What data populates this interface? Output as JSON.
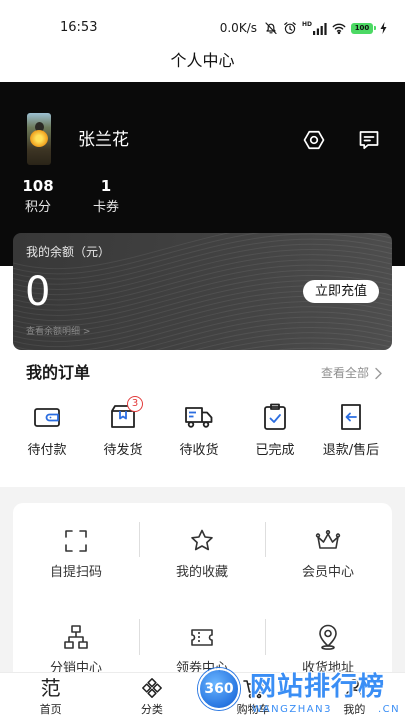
{
  "status_bar": {
    "time": "16:53",
    "net_speed": "0.0K/s",
    "signal_label": "HD",
    "battery_level": "100",
    "icons": [
      "mute-icon",
      "alarm-icon",
      "signal-icon",
      "wifi-icon",
      "battery-icon",
      "charging-icon"
    ]
  },
  "header": {
    "title": "个人中心"
  },
  "profile": {
    "name": "张兰花",
    "avatar": "avatar-photo",
    "actions": [
      {
        "icon": "settings-icon"
      },
      {
        "icon": "message-icon"
      }
    ],
    "stats": [
      {
        "value": "108",
        "label": "积分"
      },
      {
        "value": "1",
        "label": "卡券"
      }
    ]
  },
  "balance": {
    "label": "我的余额（元）",
    "amount": "0",
    "recharge_label": "立即充值",
    "detail_link": "查看余额明细 >"
  },
  "orders": {
    "title": "我的订单",
    "view_all": "查看全部",
    "items": [
      {
        "label": "待付款",
        "icon": "wallet-icon"
      },
      {
        "label": "待发货",
        "icon": "package-icon",
        "badge": "3"
      },
      {
        "label": "待收货",
        "icon": "truck-icon"
      },
      {
        "label": "已完成",
        "icon": "clipboard-check-icon"
      },
      {
        "label": "退款/售后",
        "icon": "refund-icon"
      }
    ]
  },
  "services": {
    "items": [
      {
        "label": "自提扫码",
        "icon": "scan-icon"
      },
      {
        "label": "我的收藏",
        "icon": "star-icon"
      },
      {
        "label": "会员中心",
        "icon": "crown-icon"
      },
      {
        "label": "分销中心",
        "icon": "org-chart-icon"
      },
      {
        "label": "领券中心",
        "icon": "ticket-icon"
      },
      {
        "label": "收货地址",
        "icon": "location-icon"
      }
    ]
  },
  "bottom_nav": {
    "items": [
      {
        "label": "首页",
        "icon": "home-logo-icon",
        "glyph": "范"
      },
      {
        "label": "分类",
        "icon": "category-icon"
      },
      {
        "label": "购物车",
        "icon": "cart-icon"
      },
      {
        "label": "我的",
        "icon": "user-icon"
      }
    ]
  },
  "watermark": {
    "badge": "360",
    "title": "网站排行榜",
    "url_start": "WANGZHAN3",
    "url_end": ".CN"
  },
  "colors": {
    "banner": "#0a0a0a",
    "balance_card": "#3d3d3d",
    "accent_blue": "#2b6de0",
    "badge_red": "#e23b3b",
    "battery_green": "#4cd964",
    "watermark_blue": "#3a8ef5"
  }
}
